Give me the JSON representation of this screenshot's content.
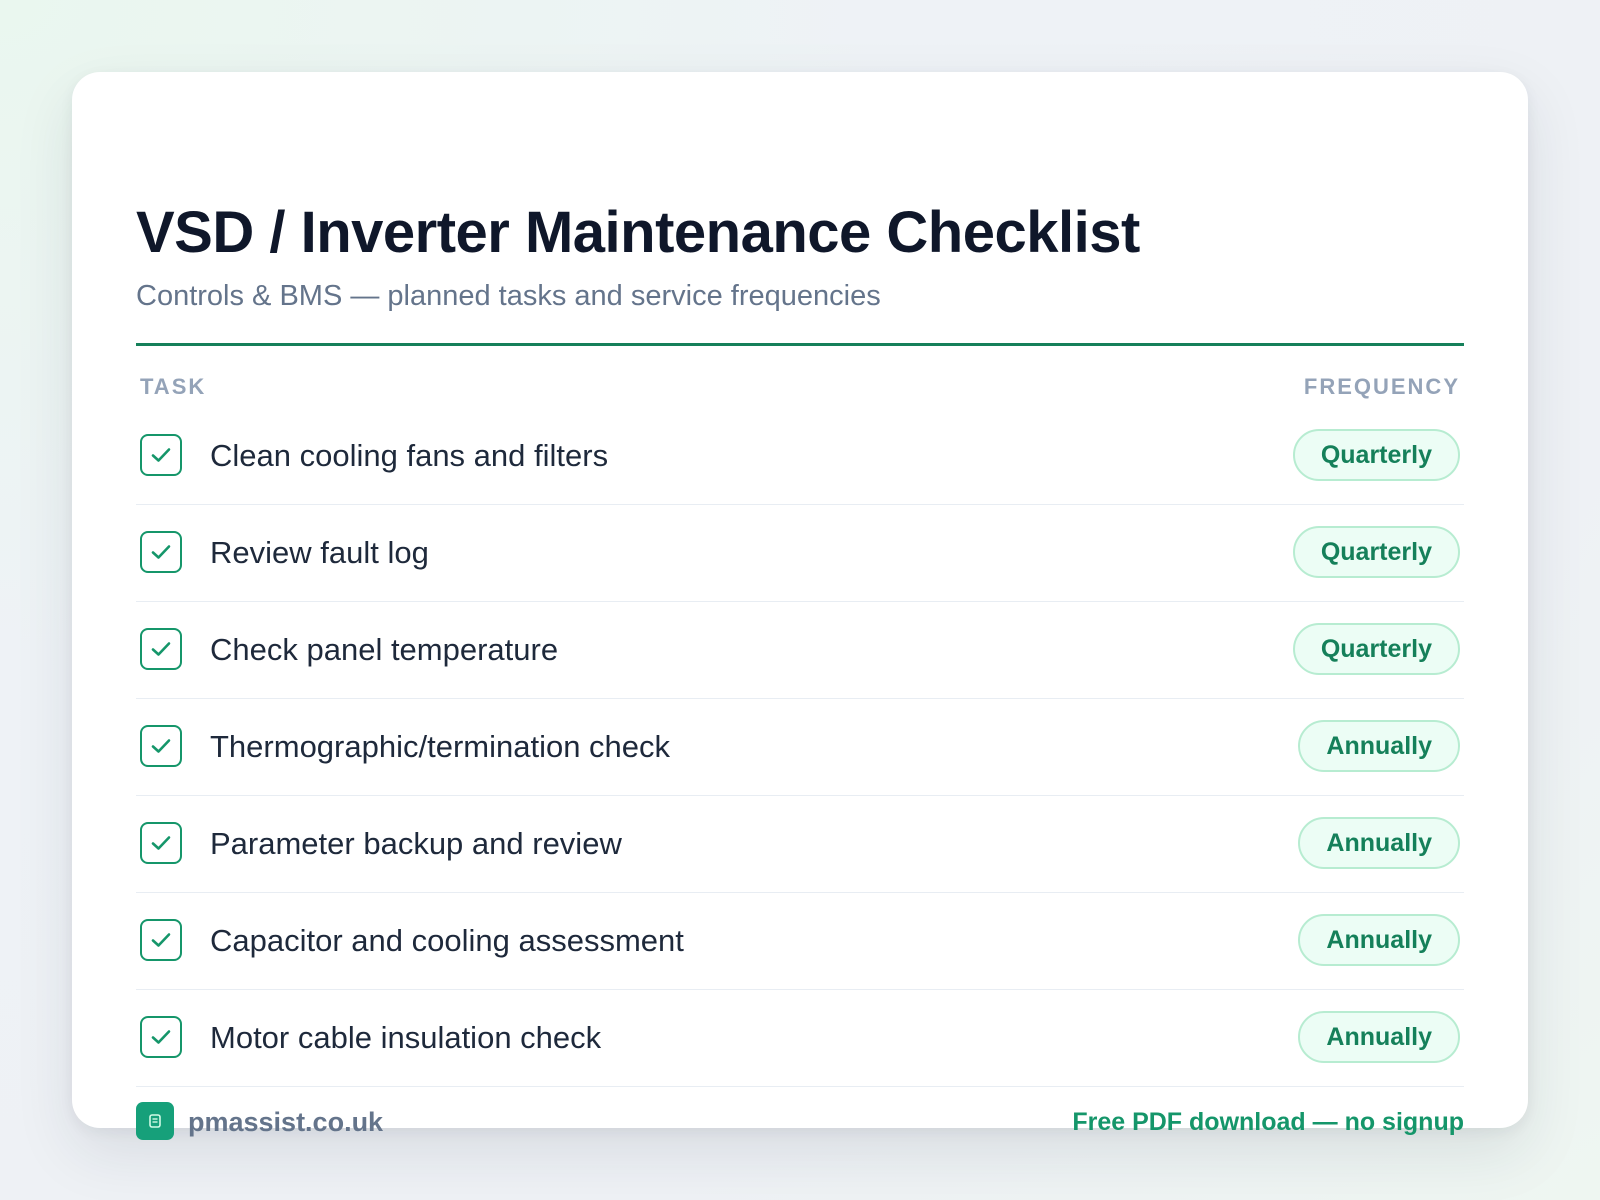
{
  "header": {
    "title": "VSD / Inverter Maintenance Checklist",
    "subtitle": "Controls & BMS — planned tasks and service frequencies"
  },
  "columns": {
    "task": "TASK",
    "frequency": "FREQUENCY"
  },
  "tasks": [
    {
      "label": "Clean cooling fans and filters",
      "frequency": "Quarterly",
      "checked": true
    },
    {
      "label": "Review fault log",
      "frequency": "Quarterly",
      "checked": true
    },
    {
      "label": "Check panel temperature",
      "frequency": "Quarterly",
      "checked": true
    },
    {
      "label": "Thermographic/termination check",
      "frequency": "Annually",
      "checked": true
    },
    {
      "label": "Parameter backup and review",
      "frequency": "Annually",
      "checked": true
    },
    {
      "label": "Capacitor and cooling assessment",
      "frequency": "Annually",
      "checked": true
    },
    {
      "label": "Motor cable insulation check",
      "frequency": "Annually",
      "checked": true
    }
  ],
  "footer": {
    "logo_icon": "document-icon",
    "site": "pmassist.co.uk",
    "download_link": "Free PDF download — no signup"
  },
  "colors": {
    "accent": "#15966a",
    "rule": "#15805a",
    "badge_bg": "#ecfdf5",
    "badge_border": "#b7ecd1",
    "title": "#0f172a",
    "muted": "#64748b"
  }
}
